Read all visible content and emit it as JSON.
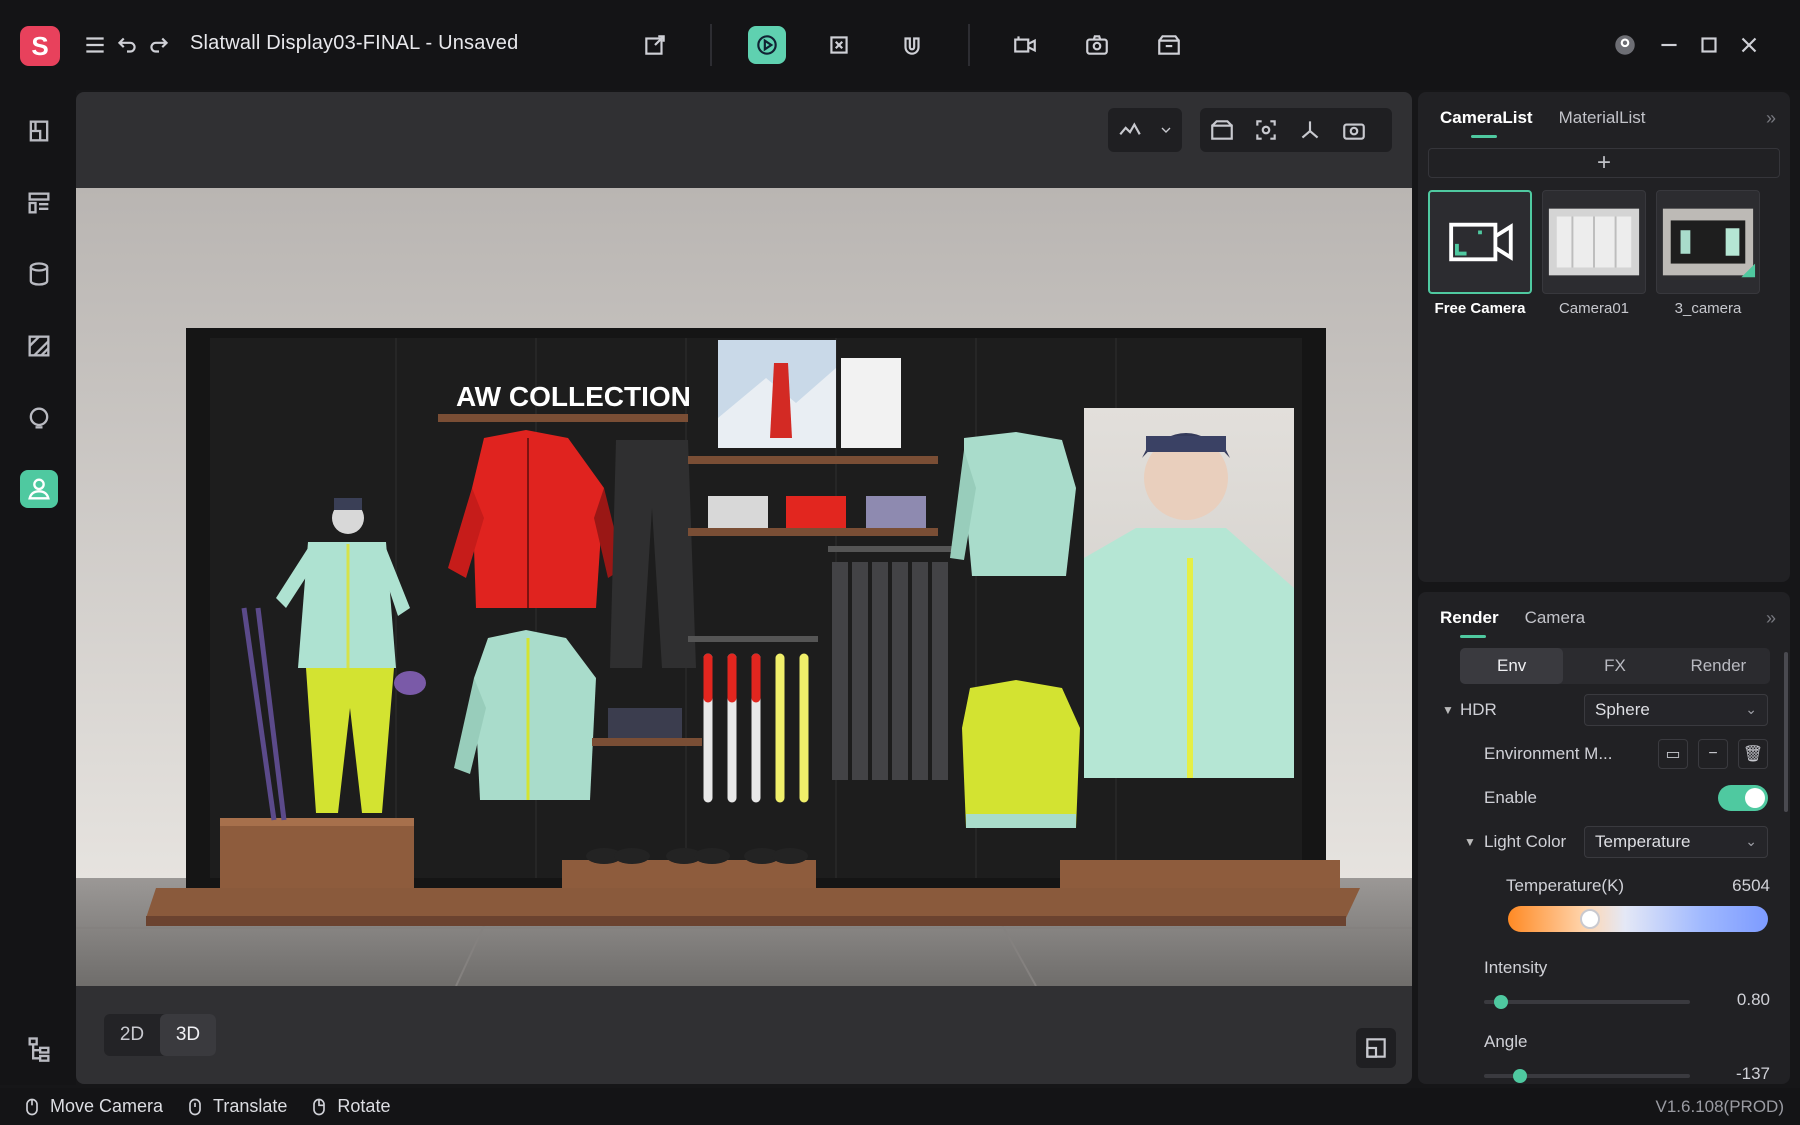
{
  "app": {
    "title": "Slatwall Display03-FINAL - Unsaved",
    "logo_letter": "S",
    "version": "V1.6.108(PROD)",
    "accent_color": "#4fc9a0",
    "brand_color": "#e8415c"
  },
  "scene": {
    "sign_text": "AW COLLECTION"
  },
  "camera_panel": {
    "tabs": [
      "CameraList",
      "MaterialList"
    ],
    "active_tab": "CameraList",
    "add_label": "+",
    "cameras": [
      {
        "label": "Free Camera",
        "selected": true
      },
      {
        "label": "Camera01",
        "selected": false
      },
      {
        "label": "3_camera",
        "selected": false
      }
    ]
  },
  "render_panel": {
    "tabs": [
      "Render",
      "Camera"
    ],
    "active_tab": "Render",
    "subtabs": [
      "Env",
      "FX",
      "Render"
    ],
    "active_subtab": "Env",
    "hdr_label": "HDR",
    "hdr_value": "Sphere",
    "env_map_label": "Environment M...",
    "enable_label": "Enable",
    "enable_on": true,
    "light_color_label": "Light Color",
    "light_color_value": "Temperature",
    "temperature_label": "Temperature(K)",
    "temperature_value": "6504",
    "temperature_fraction": 0.3,
    "intensity_label": "Intensity",
    "intensity_value": "0.80",
    "intensity_fraction": 0.05,
    "angle_label": "Angle",
    "angle_value": "-137",
    "angle_fraction": 0.15
  },
  "viewport": {
    "mode_2d": "2D",
    "mode_3d": "3D",
    "active_mode": "3D"
  },
  "statusbar": {
    "move_camera": "Move Camera",
    "translate": "Translate",
    "rotate": "Rotate"
  }
}
